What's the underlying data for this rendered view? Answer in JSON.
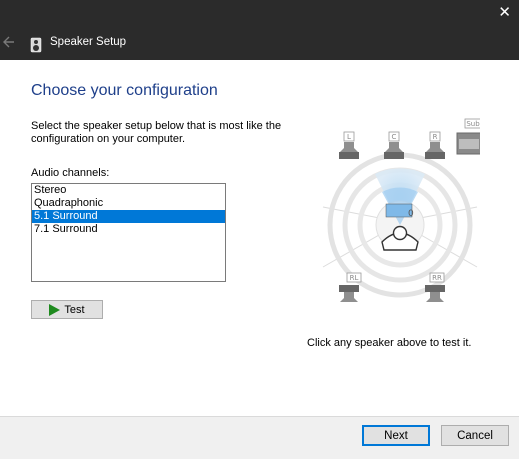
{
  "window": {
    "close_glyph": "✕"
  },
  "header": {
    "title": "Speaker Setup",
    "back_icon": "back-arrow-icon",
    "app_icon": "speaker-icon"
  },
  "main": {
    "heading": "Choose your configuration",
    "description": "Select the speaker setup below that is most like the configuration on your computer.",
    "audio_channels_label": "Audio channels:",
    "channels": [
      {
        "label": "Stereo",
        "selected": false
      },
      {
        "label": "Quadraphonic",
        "selected": false
      },
      {
        "label": "5.1 Surround",
        "selected": true
      },
      {
        "label": "7.1 Surround",
        "selected": false
      }
    ],
    "test_label": "Test",
    "hint": "Click any speaker above to test it."
  },
  "speakers": {
    "front_left": "L",
    "center": "C",
    "front_right": "R",
    "sub": "Sub",
    "rear_left": "RL",
    "rear_right": "RR"
  },
  "footer": {
    "next_label": "Next",
    "cancel_label": "Cancel"
  },
  "colors": {
    "titlebar": "#2b2b2b",
    "heading": "#1e3f8a",
    "selection": "#0078d7",
    "play": "#1e8a1e"
  }
}
